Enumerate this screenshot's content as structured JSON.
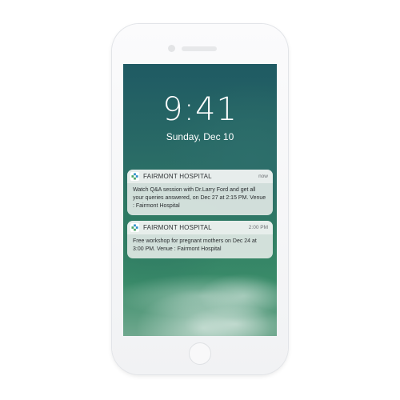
{
  "lockscreen": {
    "time": "9:41",
    "date": "Sunday, Dec 10"
  },
  "notifications": [
    {
      "app": "FAIRMONT HOSPITAL",
      "time": "now",
      "message": "Watch Q&A session with Dr.Larry Ford and get all your queries answered, on Dec 27 at 2:15 PM. Venue : Fairmont Hospital",
      "icon": "hospital-cross-icon"
    },
    {
      "app": "FAIRMONT HOSPITAL",
      "time": "2:00 PM",
      "message": "Free workshop for pregnant mothers on Dec 24 at 3:00 PM. Venue : Fairmont Hospital",
      "icon": "hospital-cross-icon"
    }
  ],
  "colors": {
    "app_icon_blue": "#2b8ec8",
    "app_icon_green": "#4aa565"
  }
}
